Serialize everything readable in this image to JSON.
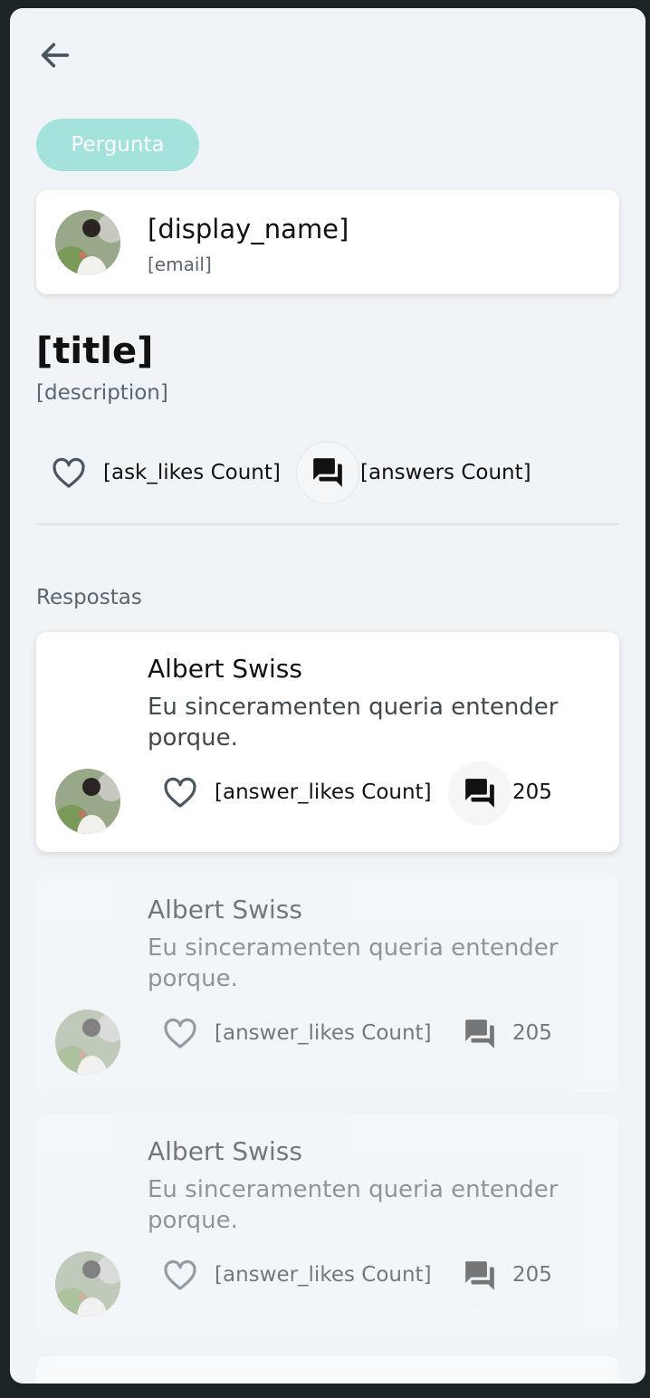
{
  "header": {
    "back_icon": "arrow-left-icon"
  },
  "tag": {
    "label": "Pergunta",
    "color": "#a3e3dc"
  },
  "author": {
    "display_name": "[display_name]",
    "email": "[email]"
  },
  "question": {
    "title": "[title]",
    "description": "[description]",
    "likes_label": "[ask_likes Count]",
    "answers_label": "[answers Count]"
  },
  "answers_section": {
    "title": "Respostas",
    "items": [
      {
        "name": "Albert Swiss",
        "text": "Eu sinceramenten queria entender porque.",
        "likes_label": "[answer_likes Count]",
        "comments_count": "205"
      },
      {
        "name": "Albert Swiss",
        "text": "Eu sinceramenten queria entender porque.",
        "likes_label": "[answer_likes Count]",
        "comments_count": "205"
      },
      {
        "name": "Albert Swiss",
        "text": "Eu sinceramenten queria entender porque.",
        "likes_label": "[answer_likes Count]",
        "comments_count": "205"
      }
    ]
  }
}
